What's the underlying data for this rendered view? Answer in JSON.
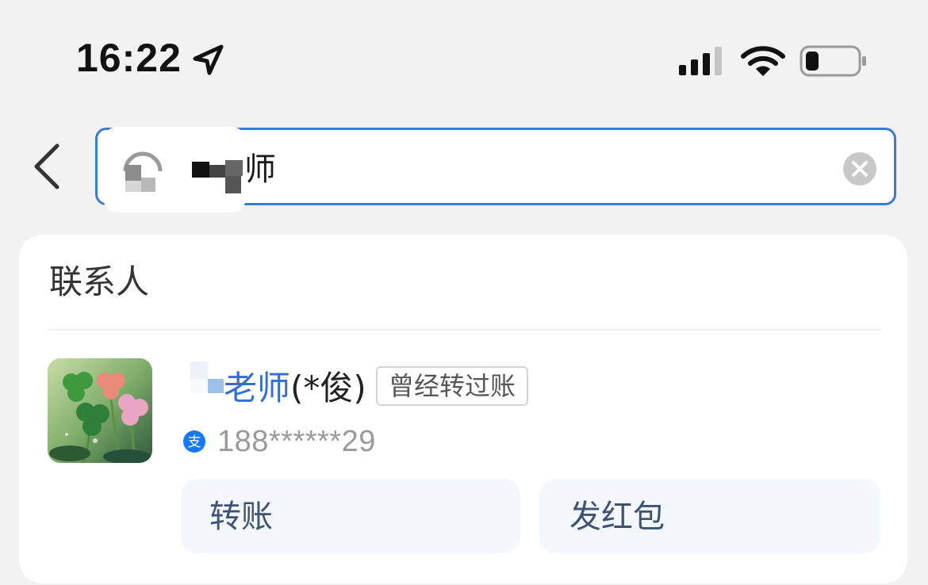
{
  "status_bar": {
    "time": "16:22",
    "location_icon": "location-arrow-icon",
    "signal_icon": "cellular-signal-icon",
    "wifi_icon": "wifi-icon",
    "battery_icon": "battery-low-icon",
    "battery_level": 0.25
  },
  "search": {
    "back_icon": "chevron-left-icon",
    "avatar_icon": "contact-avatar-icon",
    "query_visible_text": "师",
    "clear_icon": "clear-circle-icon",
    "border_color": "#3a7bd5"
  },
  "results": {
    "section_title": "联系人",
    "contacts": [
      {
        "name_highlight": "老师",
        "name_rest": "(*俊)",
        "badge": "曾经转过账",
        "phone": "188******29",
        "account_icon": "alipay-icon",
        "actions": [
          {
            "label": "转账"
          },
          {
            "label": "发红包"
          }
        ]
      }
    ]
  },
  "colors": {
    "background": "#f2f2f2",
    "card": "#ffffff",
    "highlight": "#2f6fd6",
    "action_bg": "#f4f7fc",
    "action_text": "#3d5275"
  }
}
